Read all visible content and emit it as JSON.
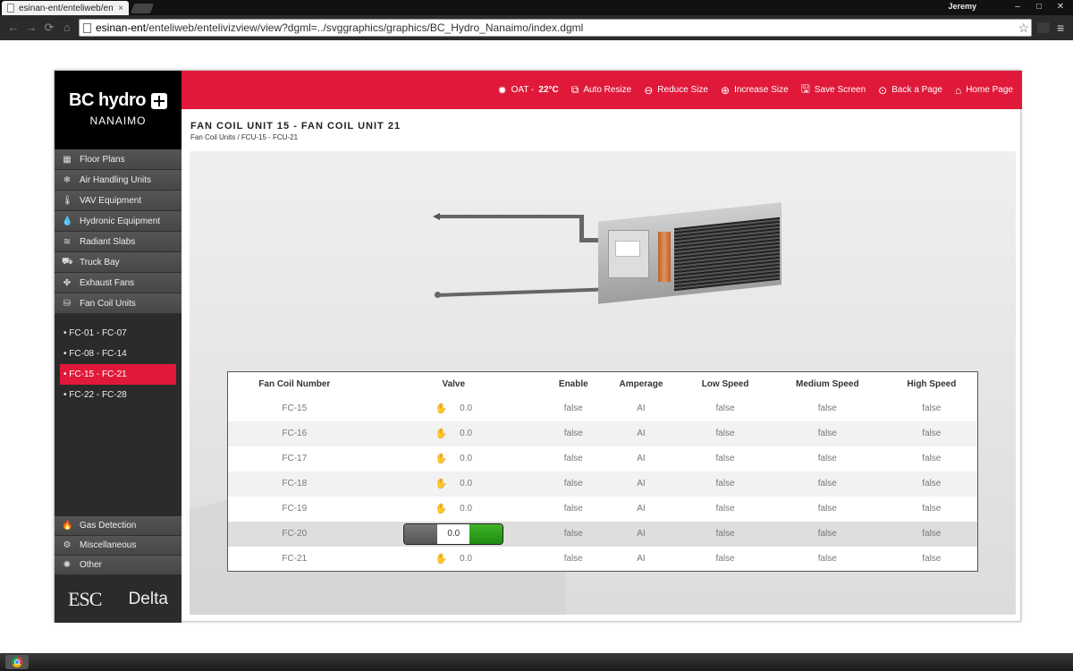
{
  "browser": {
    "tab_title": "esinan-ent/enteliweb/ente",
    "tab_close": "×",
    "user": "Jeremy",
    "url_host": "esinan-ent",
    "url_path": "/enteliweb/entelivizview/view?dgml=../svggraphics/graphics/BC_Hydro_Nanaimo/index.dgml",
    "nav_back": "←",
    "nav_forward": "→",
    "nav_reload": "⟳",
    "nav_home": "⌂",
    "star": "☆",
    "menu": "≡",
    "win_min": "–",
    "win_max": "□",
    "win_close": "✕"
  },
  "logo": {
    "brand": "BC hydro",
    "site": "NANAIMO"
  },
  "sidebar": {
    "items": [
      {
        "label": "Floor Plans",
        "icon": "▦"
      },
      {
        "label": "Air Handling Units",
        "icon": "❄"
      },
      {
        "label": "VAV Equipment",
        "icon": "🌡"
      },
      {
        "label": "Hydronic Equipment",
        "icon": "💧"
      },
      {
        "label": "Radiant Slabs",
        "icon": "≋"
      },
      {
        "label": "Truck Bay",
        "icon": "⛟"
      },
      {
        "label": "Exhaust Fans",
        "icon": "✤"
      },
      {
        "label": "Fan Coil Units",
        "icon": "⛁"
      }
    ],
    "subitems": [
      {
        "label": "• FC-01 - FC-07"
      },
      {
        "label": "• FC-08 - FC-14"
      },
      {
        "label": "• FC-15 - FC-21"
      },
      {
        "label": "• FC-22 - FC-28"
      }
    ],
    "bottom_items": [
      {
        "label": "Gas Detection",
        "icon": "🔥"
      },
      {
        "label": "Miscellaneous",
        "icon": "⚙"
      },
      {
        "label": "Other",
        "icon": "✺"
      }
    ],
    "brand_esc": "ESC",
    "brand_delta": "Delta"
  },
  "topbar": {
    "oat_label": "OAT -",
    "oat_value": "22°C",
    "oat_icon": "✹",
    "items": [
      {
        "label": "Auto Resize",
        "icon": "⧉"
      },
      {
        "label": "Reduce Size",
        "icon": "⊖"
      },
      {
        "label": "Increase Size",
        "icon": "⊕"
      },
      {
        "label": "Save Screen",
        "icon": "🖫"
      },
      {
        "label": "Back a Page",
        "icon": "⊙"
      },
      {
        "label": "Home Page",
        "icon": "⌂"
      }
    ]
  },
  "page": {
    "title": "FAN COIL UNIT 15 - FAN COIL UNIT 21",
    "breadcrumb": "Fan Coil Units / FCU-15 - FCU-21"
  },
  "table": {
    "headers": [
      "Fan Coil Number",
      "Valve",
      "Enable",
      "Amperage",
      "Low Speed",
      "Medium Speed",
      "High Speed"
    ],
    "hand_icon": "✋",
    "rows": [
      {
        "number": "FC-15",
        "valve": "0.0",
        "enable": "false",
        "amperage": "AI",
        "low": "false",
        "medium": "false",
        "high": "false"
      },
      {
        "number": "FC-16",
        "valve": "0.0",
        "enable": "false",
        "amperage": "AI",
        "low": "false",
        "medium": "false",
        "high": "false"
      },
      {
        "number": "FC-17",
        "valve": "0.0",
        "enable": "false",
        "amperage": "AI",
        "low": "false",
        "medium": "false",
        "high": "false"
      },
      {
        "number": "FC-18",
        "valve": "0.0",
        "enable": "false",
        "amperage": "AI",
        "low": "false",
        "medium": "false",
        "high": "false"
      },
      {
        "number": "FC-19",
        "valve": "0.0",
        "enable": "false",
        "amperage": "AI",
        "low": "false",
        "medium": "false",
        "high": "false"
      },
      {
        "number": "FC-20",
        "valve": "0.0",
        "enable": "false",
        "amperage": "AI",
        "low": "false",
        "medium": "false",
        "high": "false"
      },
      {
        "number": "FC-21",
        "valve": "0.0",
        "enable": "false",
        "amperage": "AI",
        "low": "false",
        "medium": "false",
        "high": "false"
      }
    ]
  },
  "colors": {
    "accent": "#e0193a",
    "sidebar": "#2b2b2b",
    "valve_on": "#2ea01b"
  }
}
